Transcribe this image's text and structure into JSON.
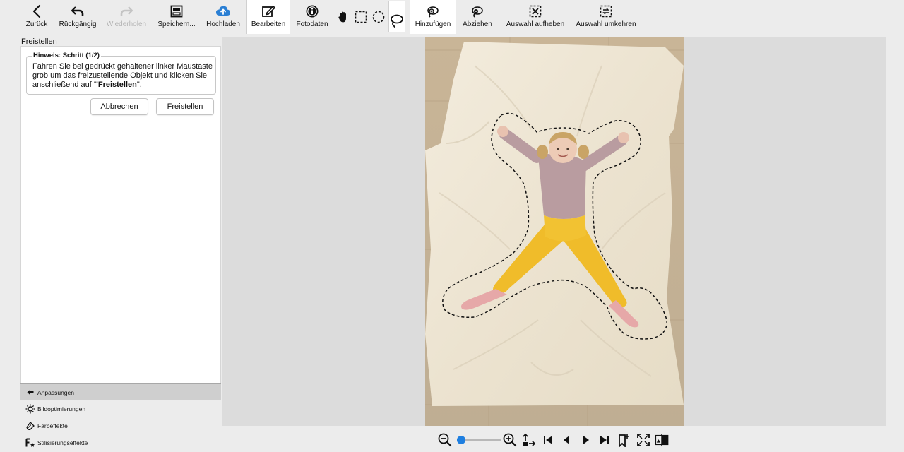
{
  "toolbar": {
    "back_label": "Zurück",
    "undo_label": "Rückgängig",
    "redo_label": "Wiederholen",
    "save_label": "Speichern...",
    "upload_label": "Hochladen",
    "edit_label": "Bearbeiten",
    "photodata_label": "Fotodaten",
    "add_label": "Hinzufügen",
    "subtract_label": "Abziehen",
    "deselect_label": "Auswahl aufheben",
    "invert_label": "Auswahl umkehren"
  },
  "panel": {
    "title": "Freistellen",
    "hint_legend": "Hinweis: Schritt (1/2)",
    "hint_text_1": "Fahren Sie bei gedrückt gehaltener linker Maustaste grob um das freizustellende Objekt und klicken Sie anschließend auf '\"",
    "hint_text_bold": "Freistellen",
    "hint_text_2": "\".",
    "cancel_label": "Abbrechen",
    "crop_label": "Freistellen"
  },
  "sections": [
    {
      "label": "Anpassungen",
      "icon": "arrow-left-icon"
    },
    {
      "label": "Bildoptimierungen",
      "icon": "sun-icon"
    },
    {
      "label": "Farbeffekte",
      "icon": "palette-icon"
    },
    {
      "label": "Stilisierungseffekte",
      "icon": "fx-icon"
    }
  ],
  "zoom": {
    "level": 0.1
  },
  "colors": {
    "accent": "#1f7fe0",
    "upload": "#2a7fd4",
    "background": "#ececec"
  }
}
